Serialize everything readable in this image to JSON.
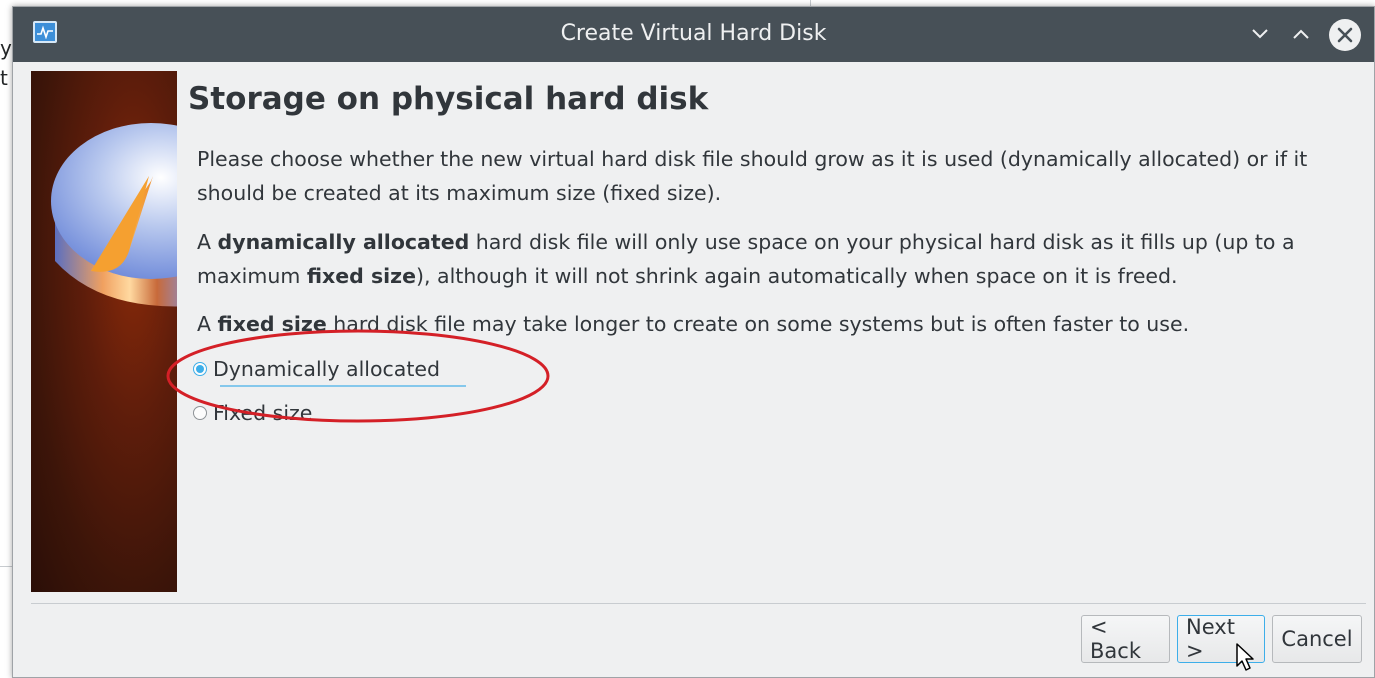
{
  "background_app": {
    "fragment_1": "y",
    "fragment_2": "t"
  },
  "window": {
    "title": "Create Virtual Hard Disk",
    "app_icon": "virtualbox-icon",
    "controls": [
      "minimize-icon",
      "maximize-icon",
      "close-icon"
    ]
  },
  "page": {
    "heading": "Storage on physical hard disk",
    "paragraph_1": "Please choose whether the new virtual hard disk file should grow as it is used (dynamically allocated) or if it should be created at its maximum size (fixed size).",
    "paragraph_2": {
      "t1": "A ",
      "b1": "dynamically allocated",
      "t2": " hard disk file will only use space on your physical hard disk as it fills up (up to a maximum ",
      "b2": "fixed size",
      "t3": "), although it will not shrink again automatically when space on it is freed."
    },
    "paragraph_3": {
      "t1": "A ",
      "b1": "fixed size",
      "t2": " hard disk file may take longer to create on some systems but is often faster to use."
    },
    "options": [
      {
        "label": "Dynamically allocated",
        "checked": true
      },
      {
        "label": "Fixed size",
        "checked": false
      }
    ]
  },
  "buttons": {
    "back": "< Back",
    "next": "Next >",
    "cancel": "Cancel"
  },
  "colors": {
    "titlebar": "#475057",
    "dialog_bg": "#eff0f1",
    "accent": "#3daee9",
    "annotation": "#d42027"
  }
}
